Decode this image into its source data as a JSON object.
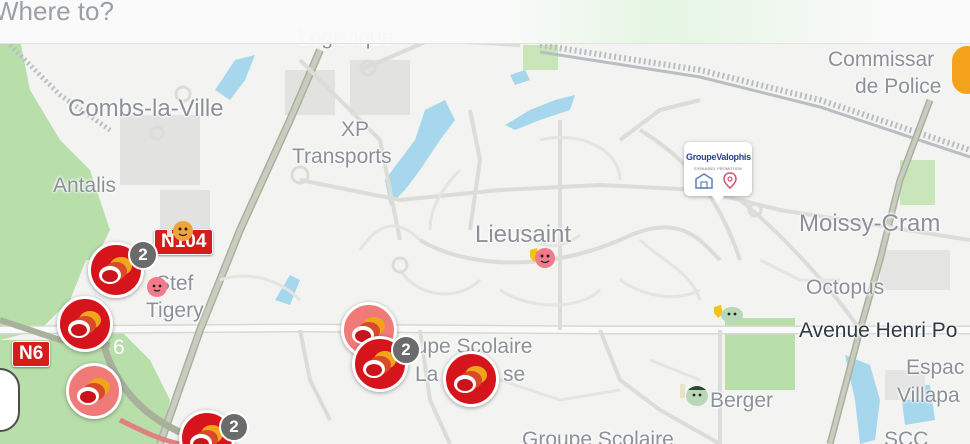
{
  "search": {
    "placeholder": "Where to?"
  },
  "places": {
    "logistique": "Logistique",
    "combs": "Combs-la-Ville",
    "xp1": "XP",
    "xp2": "Transports",
    "antalis": "Antalis",
    "lieusaint": "Lieusaint",
    "commissariat1": "Commissar",
    "commissariat2": "de Police",
    "moissy": "Moissy-Cram",
    "octopus": "Octopus",
    "stef1": "Stef",
    "stef2": "Tigery",
    "gs1_1": "oupe Scolaire",
    "gs1_2": "La",
    "gs1_3": "se",
    "gs2": "Groupe Scolaire",
    "berger": "Berger",
    "espace1": "Espac",
    "espace2": "Villapa",
    "scc": "SCC",
    "six": "6"
  },
  "streets": {
    "henri": "Avenue Henri Po"
  },
  "roads": {
    "n6": "N6",
    "n104": "N104"
  },
  "traffic_alerts": [
    {
      "count": "2"
    },
    {
      "count": ""
    },
    {
      "count": ""
    },
    {
      "count": ""
    },
    {
      "count": "2"
    },
    {
      "count": ""
    },
    {
      "count": "2"
    }
  ],
  "sponsor": {
    "name": "GroupeValophis",
    "subtitle": "EXPANSIEL PROMOTION"
  },
  "icons": [
    "traffic-jam-icon",
    "wazer-avatar-icon",
    "police-alert-icon",
    "compass-icon",
    "store-icon",
    "location-pin-icon"
  ],
  "colors": {
    "jam": "#d6141c",
    "jam_pale": "#ef7a78",
    "road_shield": "#d51d1d",
    "water": "#a6d7ec",
    "park": "#b8deaa",
    "badge": "#6b6b6b"
  }
}
